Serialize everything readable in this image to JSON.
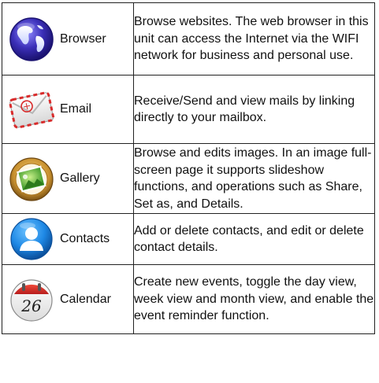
{
  "apps": [
    {
      "name": "Browser",
      "icon": "browser-globe-icon",
      "description": "Browse websites. The web browser in this unit can access the Internet via the WIFI network for business and personal use."
    },
    {
      "name": "Email",
      "icon": "email-envelope-icon",
      "description": "Receive/Send and view mails by linking directly to your mailbox."
    },
    {
      "name": "Gallery",
      "icon": "gallery-frame-icon",
      "description": "Browse and edits images. In an image full-screen page it supports slideshow functions, and operations such as Share, Set as, and Details."
    },
    {
      "name": "Contacts",
      "icon": "contacts-person-icon",
      "description": "Add or delete contacts, and edit or delete contact details."
    },
    {
      "name": "Calendar",
      "icon": "calendar-icon",
      "calendar_day": "26",
      "description": "Create new events, toggle the day view, week view and month view, and enable the event reminder function."
    }
  ],
  "colors": {
    "border": "#222222",
    "globe_blue": "#3b2fb8",
    "email_red": "#d92b2b",
    "gallery_gold": "#c8902e",
    "contacts_blue": "#1e88e5",
    "calendar_red": "#d32f2f"
  }
}
